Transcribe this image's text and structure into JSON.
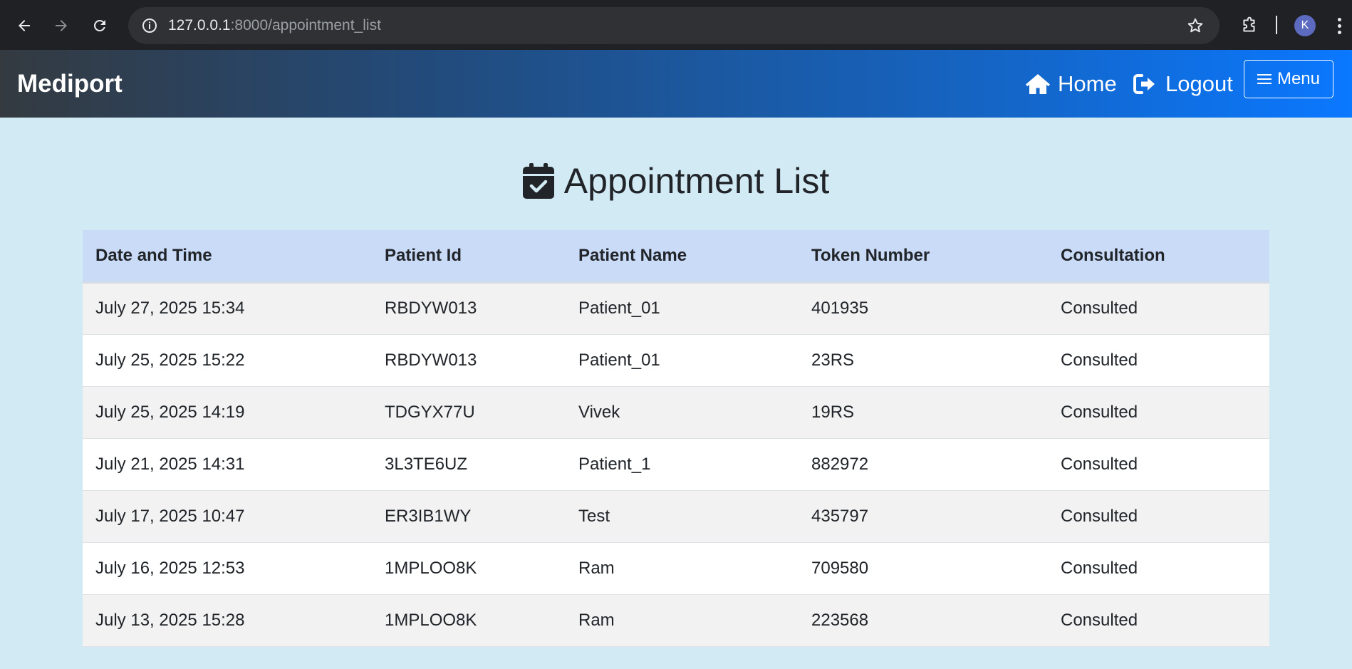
{
  "browser": {
    "url_host": "127.0.0.1",
    "url_rest": ":8000/appointment_list",
    "profile_initial": "K"
  },
  "navbar": {
    "brand": "Mediport",
    "home_label": "Home",
    "logout_label": "Logout",
    "menu_label": "Menu",
    "gradient_colors": [
      "#343a40",
      "#0a78ff"
    ]
  },
  "page": {
    "title": "Appointment List"
  },
  "table": {
    "headers": [
      "Date and Time",
      "Patient Id",
      "Patient Name",
      "Token Number",
      "Consultation"
    ],
    "rows": [
      [
        "July 27, 2025 15:34",
        "RBDYW013",
        "Patient_01",
        "401935",
        "Consulted"
      ],
      [
        "July 25, 2025 15:22",
        "RBDYW013",
        "Patient_01",
        "23RS",
        "Consulted"
      ],
      [
        "July 25, 2025 14:19",
        "TDGYX77U",
        "Vivek",
        "19RS",
        "Consulted"
      ],
      [
        "July 21, 2025 14:31",
        "3L3TE6UZ",
        "Patient_1",
        "882972",
        "Consulted"
      ],
      [
        "July 17, 2025 10:47",
        "ER3IB1WY",
        "Test",
        "435797",
        "Consulted"
      ],
      [
        "July 16, 2025 12:53",
        "1MPLOO8K",
        "Ram",
        "709580",
        "Consulted"
      ],
      [
        "July 13, 2025 15:28",
        "1MPLOO8K",
        "Ram",
        "223568",
        "Consulted"
      ]
    ]
  },
  "colors": {
    "page_background": "#d2eaf4",
    "header_row": "#c9dbf7",
    "odd_row": "#f2f2f2",
    "even_row": "#ffffff"
  }
}
